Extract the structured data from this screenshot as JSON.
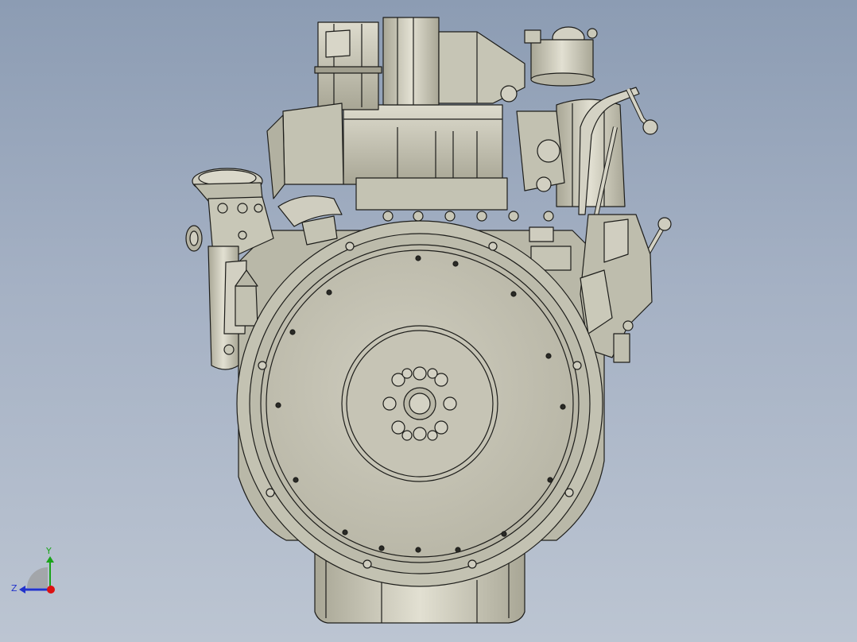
{
  "viewport": {
    "background_top": "#8c9cb3",
    "background_bottom": "#bcc5d2",
    "model_fill": "#c9c8b8",
    "model_shade": "#a9a796",
    "model_light": "#e4e2d4",
    "edge_color": "#1d1d1a"
  },
  "triad": {
    "y_label": "Y",
    "z_label": "Z",
    "y_color": "#1aa31a",
    "z_color": "#2233cc",
    "x_color": "#dd1111"
  }
}
